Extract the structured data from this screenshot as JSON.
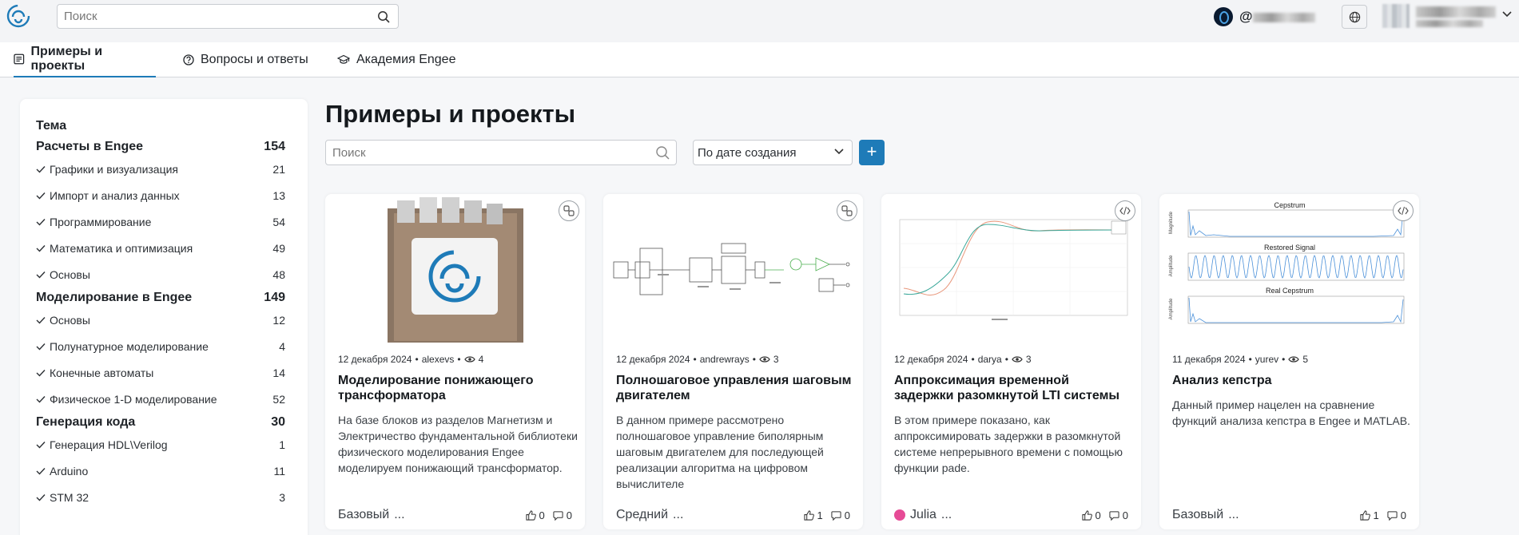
{
  "header": {
    "search_placeholder": "Поиск",
    "user_handle": "@",
    "accent": "#1e7bb8"
  },
  "nav": {
    "tabs": [
      {
        "label": "Примеры и проекты",
        "icon": "document-list-icon",
        "active": true
      },
      {
        "label": "Вопросы и ответы",
        "icon": "question-circle-icon",
        "active": false
      },
      {
        "label": "Академия Engee",
        "icon": "graduation-cap-icon",
        "active": false
      }
    ]
  },
  "sidebar": {
    "title": "Тема",
    "groups": [
      {
        "label": "Расчеты в Engee",
        "count": "154",
        "items": [
          {
            "label": "Графики и визуализация",
            "count": "21"
          },
          {
            "label": "Импорт и анализ данных",
            "count": "13"
          },
          {
            "label": "Программирование",
            "count": "54"
          },
          {
            "label": "Математика и оптимизация",
            "count": "49"
          },
          {
            "label": "Основы",
            "count": "48"
          }
        ]
      },
      {
        "label": "Моделирование в Engee",
        "count": "149",
        "items": [
          {
            "label": "Основы",
            "count": "12"
          },
          {
            "label": "Полунатурное моделирование",
            "count": "4"
          },
          {
            "label": "Конечные автоматы",
            "count": "14"
          },
          {
            "label": "Физическое 1-D моделирование",
            "count": "52"
          }
        ]
      },
      {
        "label": "Генерация кода",
        "count": "30",
        "items": [
          {
            "label": "Генерация HDL\\Verilog",
            "count": "1"
          },
          {
            "label": "Arduino",
            "count": "11"
          },
          {
            "label": "STM 32",
            "count": "3"
          }
        ]
      }
    ]
  },
  "content": {
    "title": "Примеры и проекты",
    "search_placeholder": "Поиск",
    "sort_label": "По дате создания",
    "add_label": "+"
  },
  "cards": [
    {
      "date": "12 декабря 2024",
      "author": "alexevs",
      "views": "4",
      "title": "Моделирование понижающего трансформатора",
      "desc": "На базе блоков из разделов Магнетизм и Электричество фундаментальной библиотеки физического моделирования Engee моделируем понижающий трансформатор.",
      "level": "Базовый",
      "more": "...",
      "likes": "0",
      "dislikes": "0",
      "type_icon": "model-blocks-icon"
    },
    {
      "date": "12 декабря 2024",
      "author": "andrewrays",
      "views": "3",
      "title": "Полношаговое управления шаговым двигателем",
      "desc": "В данном примере рассмотрено полношаговое управление биполярным шаговым двигателем для последующей реализации алгоритма на цифровом вычислителе",
      "level": "Средний",
      "more": "...",
      "likes": "1",
      "dislikes": "0",
      "type_icon": "model-blocks-icon"
    },
    {
      "date": "12 декабря 2024",
      "author": "darya",
      "views": "3",
      "title": "Аппроксимация временной задержки разомкнутой LTI системы",
      "desc": "В этом примере показано, как аппроксимировать задержки в разомкнутой системе непрерывного времени с помощью функции pade.",
      "level": "Julia",
      "more": "...",
      "likes": "0",
      "dislikes": "0",
      "type_icon": "code-icon"
    },
    {
      "date": "11 декабря 2024",
      "author": "yurev",
      "views": "5",
      "title": "Анализ кепстра",
      "desc": "Данный пример нацелен на сравнение функций анализа кепстра в Engee и MATLAB.",
      "level": "Базовый",
      "more": "...",
      "likes": "1",
      "dislikes": "0",
      "type_icon": "code-icon",
      "thumb": {
        "t1": "Cepstrum",
        "t2": "Restored Signal",
        "t3": "Real Cepstrum",
        "y1": "Magnitude",
        "y2": "Amplitude",
        "y3": "Amplitude"
      }
    }
  ]
}
